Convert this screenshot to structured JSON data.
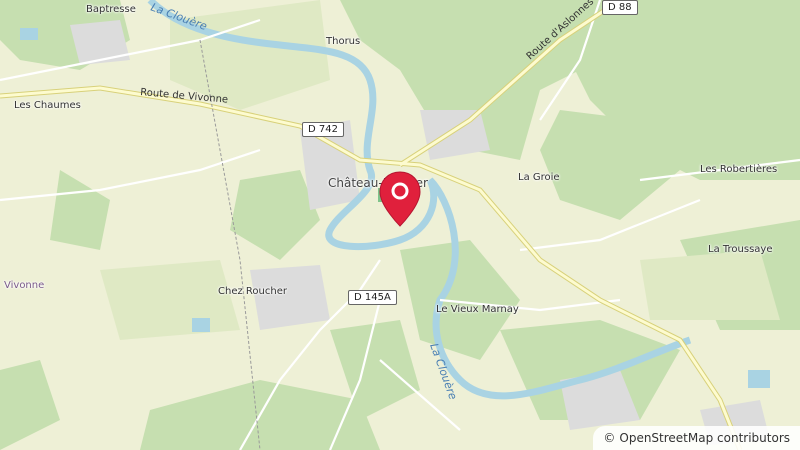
{
  "map": {
    "places": [
      {
        "id": "baptresse",
        "label": "Baptresse"
      },
      {
        "id": "thorus",
        "label": "Thorus"
      },
      {
        "id": "les-chaumes",
        "label": "Les Chaumes"
      },
      {
        "id": "chateau",
        "label": "Château-Larcher"
      },
      {
        "id": "la-groie",
        "label": "La Groie"
      },
      {
        "id": "les-robertieres",
        "label": "Les Robertières"
      },
      {
        "id": "la-troussaye",
        "label": "La Troussaye"
      },
      {
        "id": "chez-roucher",
        "label": "Chez Roucher"
      },
      {
        "id": "le-vieux-marnay",
        "label": "Le Vieux Marnay"
      },
      {
        "id": "vivonne",
        "label": "Vivonne"
      }
    ],
    "roads": {
      "route_de_vivonne": "Route de Vivonne",
      "route_dasionnes": "Route d'Aslonnes",
      "d742": "D 742",
      "d88": "D 88",
      "d145a": "D 145A"
    },
    "rivers": {
      "clouere_north": "La Clouère",
      "clouere_south": "La Clouère"
    },
    "marker_color": "#e0203c"
  },
  "attribution": {
    "symbol": "©",
    "text": "OpenStreetMap contributors"
  }
}
